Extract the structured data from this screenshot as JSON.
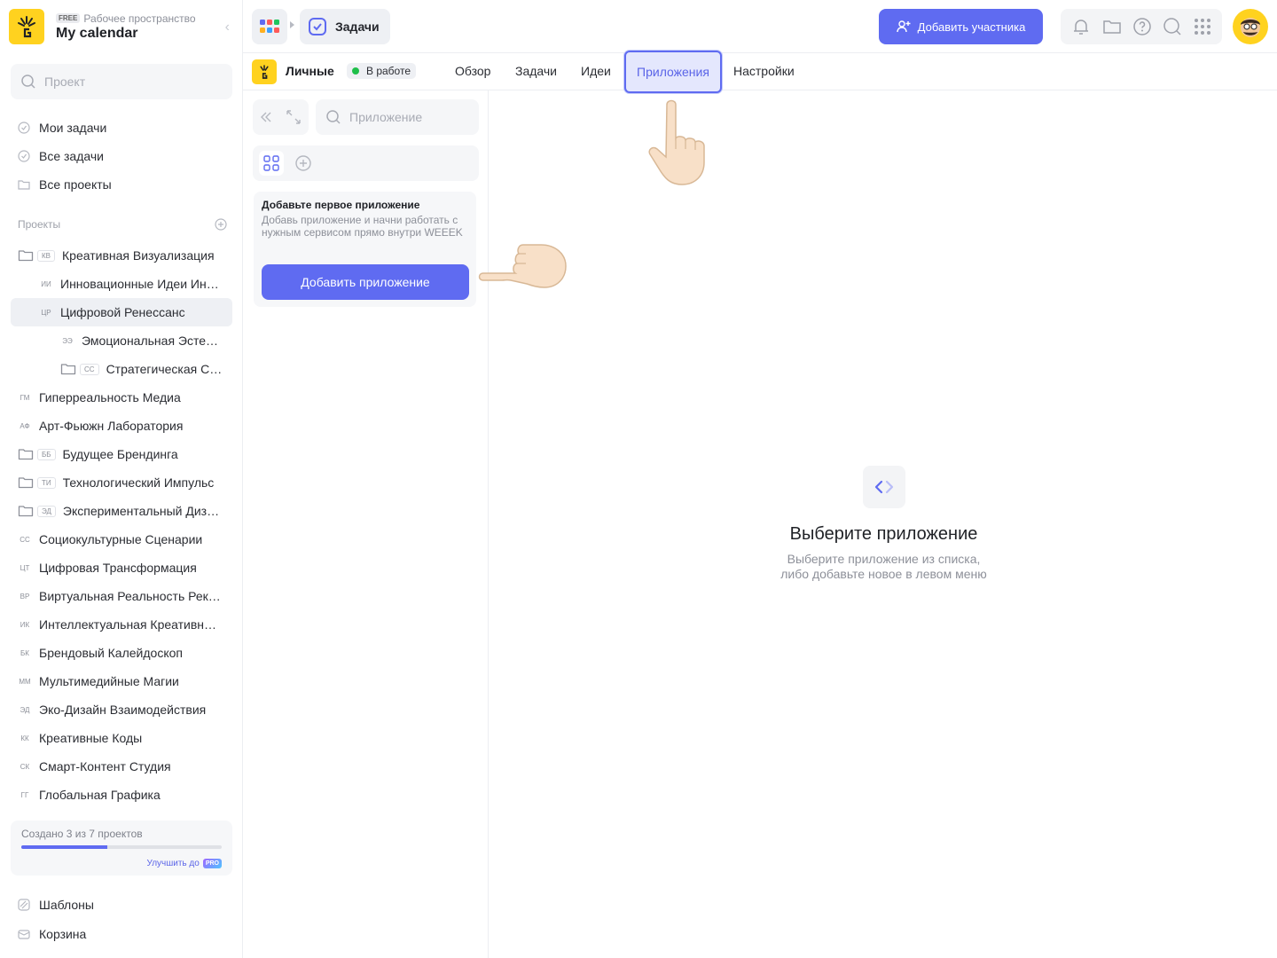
{
  "workspace": {
    "plan_badge": "FREE",
    "subtitle": "Рабочее пространство",
    "name": "My calendar"
  },
  "sidebar": {
    "search_placeholder": "Проект",
    "nav": [
      {
        "label": "Мои задачи",
        "icon": "check-circle-icon"
      },
      {
        "label": "Все задачи",
        "icon": "check-circle-icon"
      },
      {
        "label": "Все проекты",
        "icon": "folder-icon"
      }
    ],
    "projects_header": "Проекты",
    "projects": [
      {
        "abbr": "КВ",
        "name": "Креативная Визуализация",
        "folder": true,
        "level": 0
      },
      {
        "abbr": "ИИ",
        "name": "Инновационные Идеи Ин…",
        "folder": false,
        "level": 1
      },
      {
        "abbr": "ЦР",
        "name": "Цифровой Ренессанс",
        "folder": false,
        "level": 1,
        "active": true
      },
      {
        "abbr": "ЭЭ",
        "name": "Эмоциональная Эсте…",
        "folder": false,
        "level": 2
      },
      {
        "abbr": "СС",
        "name": "Стратегическая С…",
        "folder": true,
        "level": 2
      },
      {
        "abbr": "ГМ",
        "name": "Гиперреальность Медиа",
        "folder": false,
        "level": 0
      },
      {
        "abbr": "АФ",
        "name": "Арт-Фьюжн Лаборатория",
        "folder": false,
        "level": 0
      },
      {
        "abbr": "ББ",
        "name": "Будущее Брендинга",
        "folder": true,
        "level": 0
      },
      {
        "abbr": "ТИ",
        "name": "Технологический Импульс",
        "folder": true,
        "level": 0
      },
      {
        "abbr": "ЭД",
        "name": "Экспериментальный Диз…",
        "folder": true,
        "level": 0
      },
      {
        "abbr": "СС",
        "name": "Социокультурные Сценарии",
        "folder": false,
        "level": 0
      },
      {
        "abbr": "ЦТ",
        "name": "Цифровая Трансформация",
        "folder": false,
        "level": 0
      },
      {
        "abbr": "ВР",
        "name": "Виртуальная Реальность Рек…",
        "folder": false,
        "level": 0
      },
      {
        "abbr": "ИК",
        "name": "Интеллектуальная Креативн…",
        "folder": false,
        "level": 0
      },
      {
        "abbr": "БК",
        "name": "Брендовый Калейдоскоп",
        "folder": false,
        "level": 0
      },
      {
        "abbr": "ММ",
        "name": "Мультимедийные Магии",
        "folder": false,
        "level": 0
      },
      {
        "abbr": "ЭД",
        "name": "Эко-Дизайн Взаимодействия",
        "folder": false,
        "level": 0
      },
      {
        "abbr": "КК",
        "name": "Креативные Коды",
        "folder": false,
        "level": 0
      },
      {
        "abbr": "СК",
        "name": "Смарт-Контент Студия",
        "folder": false,
        "level": 0
      },
      {
        "abbr": "ГГ",
        "name": "Глобальная Графика",
        "folder": false,
        "level": 0
      }
    ],
    "quota": {
      "text": "Создано 3 из 7 проектов",
      "used": 3,
      "total": 7,
      "upgrade_label": "Улучшить до",
      "pro_badge": "PRO"
    },
    "bottom": [
      {
        "label": "Шаблоны",
        "icon": "templates-icon"
      },
      {
        "label": "Корзина",
        "icon": "trash-icon"
      }
    ]
  },
  "topbar": {
    "breadcrumb_current": "Задачи",
    "add_member_label": "Добавить участника",
    "tool_icons": [
      "bell-icon",
      "folder-icon",
      "help-icon",
      "search-icon",
      "apps-icon"
    ]
  },
  "project": {
    "name": "Личные",
    "status": "В работе",
    "status_color": "#1fbf4a",
    "tabs": [
      "Обзор",
      "Задачи",
      "Идеи",
      "Приложения",
      "Настройки"
    ],
    "active_tab": "Приложения"
  },
  "apps": {
    "search_placeholder": "Приложение",
    "first_title": "Добавьте первое приложение",
    "first_desc": "Добавь приложение и начни работать с нужным сервисом прямо внутри WEEEK",
    "add_button": "Добавить приложение"
  },
  "empty": {
    "title": "Выберите приложение",
    "line1": "Выберите приложение из списка,",
    "line2": "либо добавьте новое в левом меню"
  },
  "colors": {
    "accent": "#5f6bf1",
    "brand_yellow": "#ffd21f"
  }
}
